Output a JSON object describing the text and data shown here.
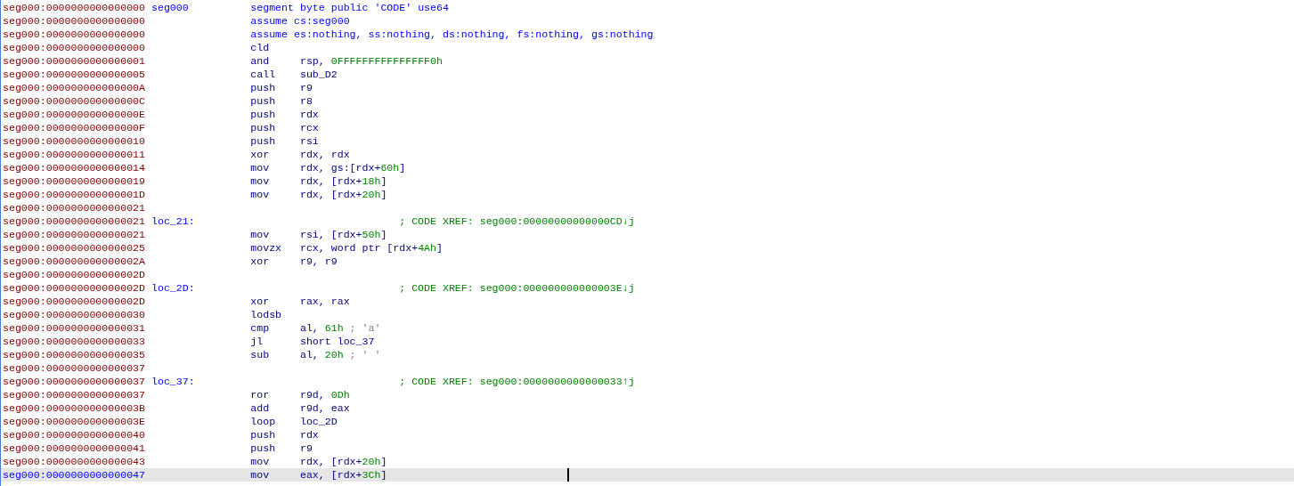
{
  "lines": [
    {
      "address": "seg000:0000000000000000",
      "label": "seg000",
      "kind": "directive",
      "text": "segment byte public 'CODE' use64",
      "selected": false
    },
    {
      "address": "seg000:0000000000000000",
      "kind": "directive",
      "text": "assume cs:seg000",
      "selected": false
    },
    {
      "address": "seg000:0000000000000000",
      "kind": "directive",
      "text": "assume es:nothing, ss:nothing, ds:nothing, fs:nothing, gs:nothing",
      "selected": false
    },
    {
      "address": "seg000:0000000000000000",
      "kind": "instruction",
      "mnemonic": "cld",
      "selected": false
    },
    {
      "address": "seg000:0000000000000001",
      "kind": "instruction",
      "mnemonic": "and",
      "operands": [
        {
          "text": "rsp, ",
          "kind": "reg"
        },
        {
          "text": "0FFFFFFFFFFFFFFF0h",
          "kind": "number"
        }
      ],
      "selected": false
    },
    {
      "address": "seg000:0000000000000005",
      "kind": "instruction",
      "mnemonic": "call",
      "operands": [
        {
          "text": "sub_D2",
          "kind": "reg"
        }
      ],
      "selected": false
    },
    {
      "address": "seg000:000000000000000A",
      "kind": "instruction",
      "mnemonic": "push",
      "operands": [
        {
          "text": "r9",
          "kind": "reg"
        }
      ],
      "selected": false
    },
    {
      "address": "seg000:000000000000000C",
      "kind": "instruction",
      "mnemonic": "push",
      "operands": [
        {
          "text": "r8",
          "kind": "reg"
        }
      ],
      "selected": false
    },
    {
      "address": "seg000:000000000000000E",
      "kind": "instruction",
      "mnemonic": "push",
      "operands": [
        {
          "text": "rdx",
          "kind": "reg"
        }
      ],
      "selected": false
    },
    {
      "address": "seg000:000000000000000F",
      "kind": "instruction",
      "mnemonic": "push",
      "operands": [
        {
          "text": "rcx",
          "kind": "reg"
        }
      ],
      "selected": false
    },
    {
      "address": "seg000:0000000000000010",
      "kind": "instruction",
      "mnemonic": "push",
      "operands": [
        {
          "text": "rsi",
          "kind": "reg"
        }
      ],
      "selected": false
    },
    {
      "address": "seg000:0000000000000011",
      "kind": "instruction",
      "mnemonic": "xor",
      "operands": [
        {
          "text": "rdx, rdx",
          "kind": "reg"
        }
      ],
      "selected": false
    },
    {
      "address": "seg000:0000000000000014",
      "kind": "instruction",
      "mnemonic": "mov",
      "operands": [
        {
          "text": "rdx, gs:[rdx+",
          "kind": "reg"
        },
        {
          "text": "60h",
          "kind": "number"
        },
        {
          "text": "]",
          "kind": "reg"
        }
      ],
      "selected": false
    },
    {
      "address": "seg000:0000000000000019",
      "kind": "instruction",
      "mnemonic": "mov",
      "operands": [
        {
          "text": "rdx, [rdx+",
          "kind": "reg"
        },
        {
          "text": "18h",
          "kind": "number"
        },
        {
          "text": "]",
          "kind": "reg"
        }
      ],
      "selected": false
    },
    {
      "address": "seg000:000000000000001D",
      "kind": "instruction",
      "mnemonic": "mov",
      "operands": [
        {
          "text": "rdx, [rdx+",
          "kind": "reg"
        },
        {
          "text": "20h",
          "kind": "number"
        },
        {
          "text": "]",
          "kind": "reg"
        }
      ],
      "selected": false
    },
    {
      "address": "seg000:0000000000000021",
      "kind": "blank",
      "selected": false
    },
    {
      "address": "seg000:0000000000000021",
      "label": "loc_21:",
      "kind": "label",
      "comment": "; CODE XREF: seg000:00000000000000CD↓j",
      "selected": false
    },
    {
      "address": "seg000:0000000000000021",
      "kind": "instruction",
      "mnemonic": "mov",
      "operands": [
        {
          "text": "rsi, [rdx+",
          "kind": "reg"
        },
        {
          "text": "50h",
          "kind": "number"
        },
        {
          "text": "]",
          "kind": "reg"
        }
      ],
      "selected": false
    },
    {
      "address": "seg000:0000000000000025",
      "kind": "instruction",
      "mnemonic": "movzx",
      "operands": [
        {
          "text": "rcx, word ptr [rdx+",
          "kind": "reg"
        },
        {
          "text": "4Ah",
          "kind": "number"
        },
        {
          "text": "]",
          "kind": "reg"
        }
      ],
      "selected": false
    },
    {
      "address": "seg000:000000000000002A",
      "kind": "instruction",
      "mnemonic": "xor",
      "operands": [
        {
          "text": "r9, r9",
          "kind": "reg"
        }
      ],
      "selected": false
    },
    {
      "address": "seg000:000000000000002D",
      "kind": "blank",
      "selected": false
    },
    {
      "address": "seg000:000000000000002D",
      "label": "loc_2D:",
      "kind": "label",
      "comment": "; CODE XREF: seg000:000000000000003E↓j",
      "selected": false
    },
    {
      "address": "seg000:000000000000002D",
      "kind": "instruction",
      "mnemonic": "xor",
      "operands": [
        {
          "text": "rax, rax",
          "kind": "reg"
        }
      ],
      "selected": false
    },
    {
      "address": "seg000:0000000000000030",
      "kind": "instruction",
      "mnemonic": "lodsb",
      "selected": false
    },
    {
      "address": "seg000:0000000000000031",
      "kind": "instruction",
      "mnemonic": "cmp",
      "operands": [
        {
          "text": "al, ",
          "kind": "reg"
        },
        {
          "text": "61h",
          "kind": "number"
        },
        {
          "text": " ; 'a'",
          "kind": "comment"
        }
      ],
      "selected": false
    },
    {
      "address": "seg000:0000000000000033",
      "kind": "instruction",
      "mnemonic": "jl",
      "operands": [
        {
          "text": "short loc_37",
          "kind": "reg"
        }
      ],
      "selected": false
    },
    {
      "address": "seg000:0000000000000035",
      "kind": "instruction",
      "mnemonic": "sub",
      "operands": [
        {
          "text": "al, ",
          "kind": "reg"
        },
        {
          "text": "20h",
          "kind": "number"
        },
        {
          "text": " ; ' '",
          "kind": "comment"
        }
      ],
      "selected": false
    },
    {
      "address": "seg000:0000000000000037",
      "kind": "blank",
      "selected": false
    },
    {
      "address": "seg000:0000000000000037",
      "label": "loc_37:",
      "kind": "label",
      "comment": "; CODE XREF: seg000:0000000000000033↑j",
      "selected": false
    },
    {
      "address": "seg000:0000000000000037",
      "kind": "instruction",
      "mnemonic": "ror",
      "operands": [
        {
          "text": "r9d, ",
          "kind": "reg"
        },
        {
          "text": "0Dh",
          "kind": "number"
        }
      ],
      "selected": false
    },
    {
      "address": "seg000:000000000000003B",
      "kind": "instruction",
      "mnemonic": "add",
      "operands": [
        {
          "text": "r9d, eax",
          "kind": "reg"
        }
      ],
      "selected": false
    },
    {
      "address": "seg000:000000000000003E",
      "kind": "instruction",
      "mnemonic": "loop",
      "operands": [
        {
          "text": "loc_2D",
          "kind": "reg"
        }
      ],
      "selected": false
    },
    {
      "address": "seg000:0000000000000040",
      "kind": "instruction",
      "mnemonic": "push",
      "operands": [
        {
          "text": "rdx",
          "kind": "reg"
        }
      ],
      "selected": false
    },
    {
      "address": "seg000:0000000000000041",
      "kind": "instruction",
      "mnemonic": "push",
      "operands": [
        {
          "text": "r9",
          "kind": "reg"
        }
      ],
      "selected": false
    },
    {
      "address": "seg000:0000000000000043",
      "kind": "instruction",
      "mnemonic": "mov",
      "operands": [
        {
          "text": "rdx, [rdx+",
          "kind": "reg"
        },
        {
          "text": "20h",
          "kind": "number"
        },
        {
          "text": "]",
          "kind": "reg"
        }
      ],
      "selected": false
    },
    {
      "address": "seg000:0000000000000047",
      "kind": "instruction",
      "mnemonic": "mov",
      "operands": [
        {
          "text": "eax, [rdx+",
          "kind": "reg"
        },
        {
          "text": "3Ch",
          "kind": "number"
        },
        {
          "text": "]",
          "kind": "reg"
        }
      ],
      "selected": true
    }
  ]
}
